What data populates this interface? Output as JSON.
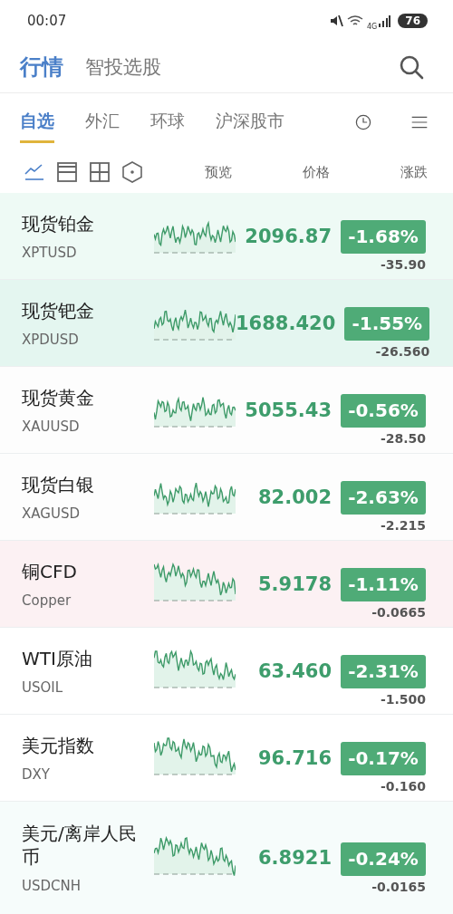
{
  "status_bar": {
    "time": "00:07",
    "network": "4G",
    "battery": "76"
  },
  "header": {
    "tabs": [
      {
        "label": "行情",
        "selected": true
      },
      {
        "label": "智投选股",
        "selected": false
      }
    ]
  },
  "market_tabs": [
    {
      "label": "自选",
      "selected": true
    },
    {
      "label": "外汇",
      "selected": false
    },
    {
      "label": "环球",
      "selected": false
    },
    {
      "label": "沪深股市",
      "selected": false
    }
  ],
  "view_modes": [
    {
      "kind": "line",
      "selected": true
    },
    {
      "kind": "rows",
      "selected": false
    },
    {
      "kind": "grid",
      "selected": false
    },
    {
      "kind": "hexagon",
      "selected": false
    }
  ],
  "table": {
    "columns": [
      "预览",
      "价格",
      "涨跌"
    ],
    "rows": [
      {
        "name": "现货铂金",
        "code": "XPTUSD",
        "price": "2096.87",
        "percent": "-1.68%",
        "change": "-35.90",
        "color": "#eefaf5"
      },
      {
        "name": "现货钯金",
        "code": "XPDUSD",
        "price": "1688.420",
        "percent": "-1.55%",
        "change": "-26.560",
        "color": "#e4f6f0"
      },
      {
        "name": "现货黄金",
        "code": "XAUUSD",
        "price": "5055.43",
        "percent": "-0.56%",
        "change": "-28.50",
        "color": "#fdfdfd"
      },
      {
        "name": "现货白银",
        "code": "XAGUSD",
        "price": "82.002",
        "percent": "-2.63%",
        "change": "-2.215",
        "color": "#fdfdfd"
      },
      {
        "name": "铜CFD",
        "code": "Copper",
        "price": "5.9178",
        "percent": "-1.11%",
        "change": "-0.0665",
        "color": "#fcf1f3"
      },
      {
        "name": "WTI原油",
        "code": "USOIL",
        "price": "63.460",
        "percent": "-2.31%",
        "change": "-1.500",
        "color": "#ffffff"
      },
      {
        "name": "美元指数",
        "code": "DXY",
        "price": "96.716",
        "percent": "-0.17%",
        "change": "-0.160",
        "color": "#ffffff"
      },
      {
        "name": "美元/离岸人民币",
        "code": "USDCNH",
        "price": "6.8921",
        "percent": "-0.24%",
        "change": "-0.0165",
        "color": "#f6fcfb"
      }
    ]
  }
}
